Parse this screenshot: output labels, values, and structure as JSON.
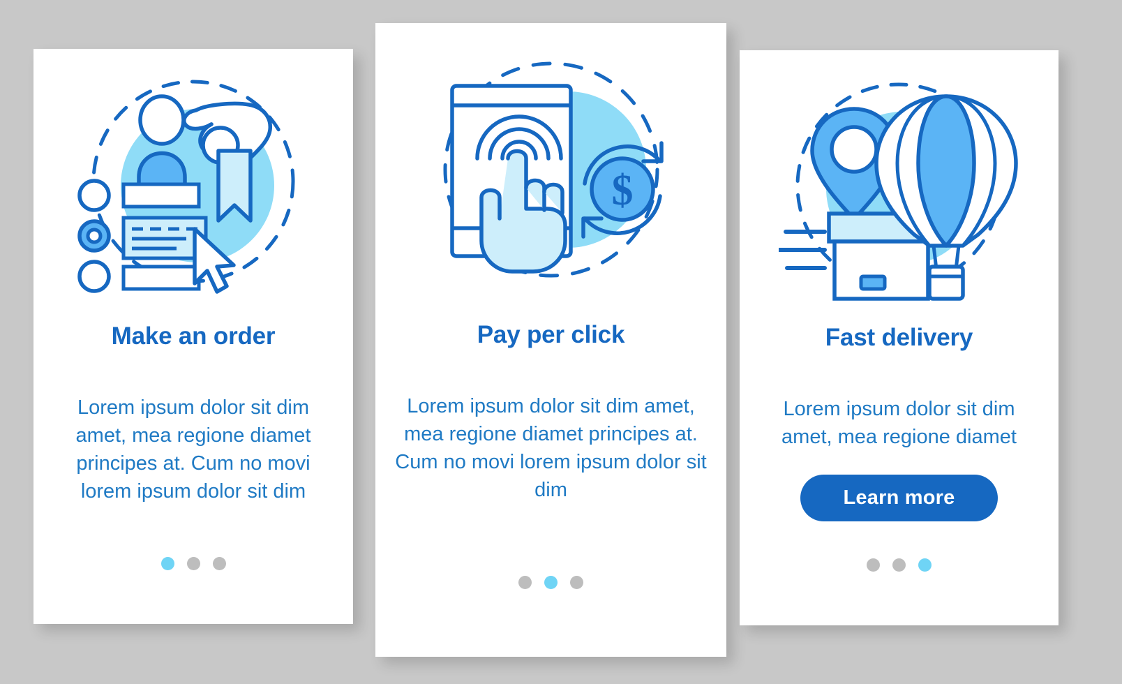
{
  "background_color": "#c8c8c8",
  "colors": {
    "card_bg": "#ffffff",
    "title": "#1668c1",
    "body_text": "#1f7ac4",
    "accent_dark_blue": "#1668c1",
    "accent_mid_blue": "#5bb4f5",
    "accent_light_blue": "#8fdcf7",
    "accent_pale_blue": "#cdeefb",
    "dot_inactive": "#bdbdbd",
    "dot_active": "#6fd4f5",
    "button_bg": "#1668c1",
    "button_text": "#ffffff"
  },
  "screens": [
    {
      "id": "make-an-order",
      "illustration": "order-form-illustration",
      "illustration_parts": [
        "person-avatar-icon",
        "hand-bookmark-icon",
        "radio-button-list-icon",
        "cursor-arrow-icon"
      ],
      "title": "Make an order",
      "description": "Lorem ipsum dolor sit dim amet, mea regione diamet principes at. Cum no movi lorem ipsum dolor sit dim",
      "has_button": false,
      "button_label": "",
      "dots": {
        "count": 3,
        "active_index": 0
      }
    },
    {
      "id": "pay-per-click",
      "illustration": "pay-per-click-illustration",
      "illustration_parts": [
        "smartphone-icon",
        "tap-hand-icon",
        "ripple-icon",
        "refresh-arrows-icon",
        "dollar-coin-icon"
      ],
      "title": "Pay per click",
      "description": "Lorem ipsum dolor sit dim amet, mea regione diamet principes at. Cum no movi lorem ipsum dolor sit dim",
      "has_button": false,
      "button_label": "",
      "dots": {
        "count": 3,
        "active_index": 1
      }
    },
    {
      "id": "fast-delivery",
      "illustration": "fast-delivery-illustration",
      "illustration_parts": [
        "location-pin-icon",
        "package-box-icon",
        "speed-lines-icon",
        "hot-air-balloon-icon"
      ],
      "title": "Fast delivery",
      "description": "Lorem ipsum dolor sit dim amet, mea regione diamet",
      "has_button": true,
      "button_label": "Learn more",
      "dots": {
        "count": 3,
        "active_index": 2
      }
    }
  ]
}
